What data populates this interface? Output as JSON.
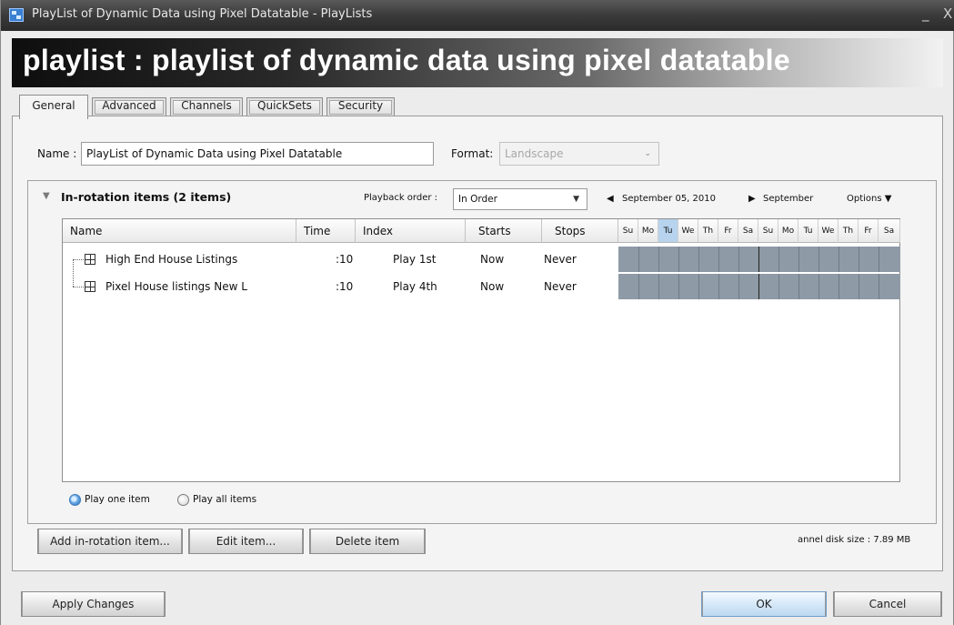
{
  "window": {
    "title": "PlayList of Dynamic Data using Pixel Datatable - PlayLists",
    "minimize": "_",
    "close": "X"
  },
  "banner": {
    "title": "playlist : playlist of dynamic data using pixel datatable"
  },
  "tabs": [
    "General",
    "Advanced",
    "Channels",
    "QuickSets",
    "Security"
  ],
  "general": {
    "name_label": "Name :",
    "name_value": "PlayList of Dynamic Data using Pixel Datatable",
    "format_label": "Format:",
    "format_value": "Landscape"
  },
  "rotation": {
    "collapse_glyph": "▼",
    "title": "In-rotation items (2 items)",
    "playback_label": "Playback order :",
    "playback_value": "In Order",
    "prev_glyph": "◀",
    "date_label": "September 05, 2010",
    "next_glyph": "▶",
    "next_label": "September",
    "options_label": "Options ▼"
  },
  "columns": [
    "Name",
    "Time",
    "Index",
    "Starts",
    "Stops"
  ],
  "days": [
    "Su",
    "Mo",
    "Tu",
    "We",
    "Th",
    "Fr",
    "Sa",
    "Su",
    "Mo",
    "Tu",
    "We",
    "Th",
    "Fr",
    "Sa"
  ],
  "rows": [
    {
      "name": "High End House Listings",
      "time": ":10",
      "index": "Play 1st",
      "starts": "Now",
      "stops": "Never"
    },
    {
      "name": "Pixel House listings New L",
      "time": ":10",
      "index": "Play 4th",
      "starts": "Now",
      "stops": "Never"
    }
  ],
  "play_mode": {
    "one": "Play one item",
    "all": "Play all items",
    "selected": "one"
  },
  "buttons": {
    "add": "Add in-rotation item...",
    "edit": "Edit item...",
    "delete": "Delete item",
    "apply": "Apply Changes",
    "ok": "OK",
    "cancel": "Cancel"
  },
  "disk_size": "annel disk size : 7.89 MB"
}
